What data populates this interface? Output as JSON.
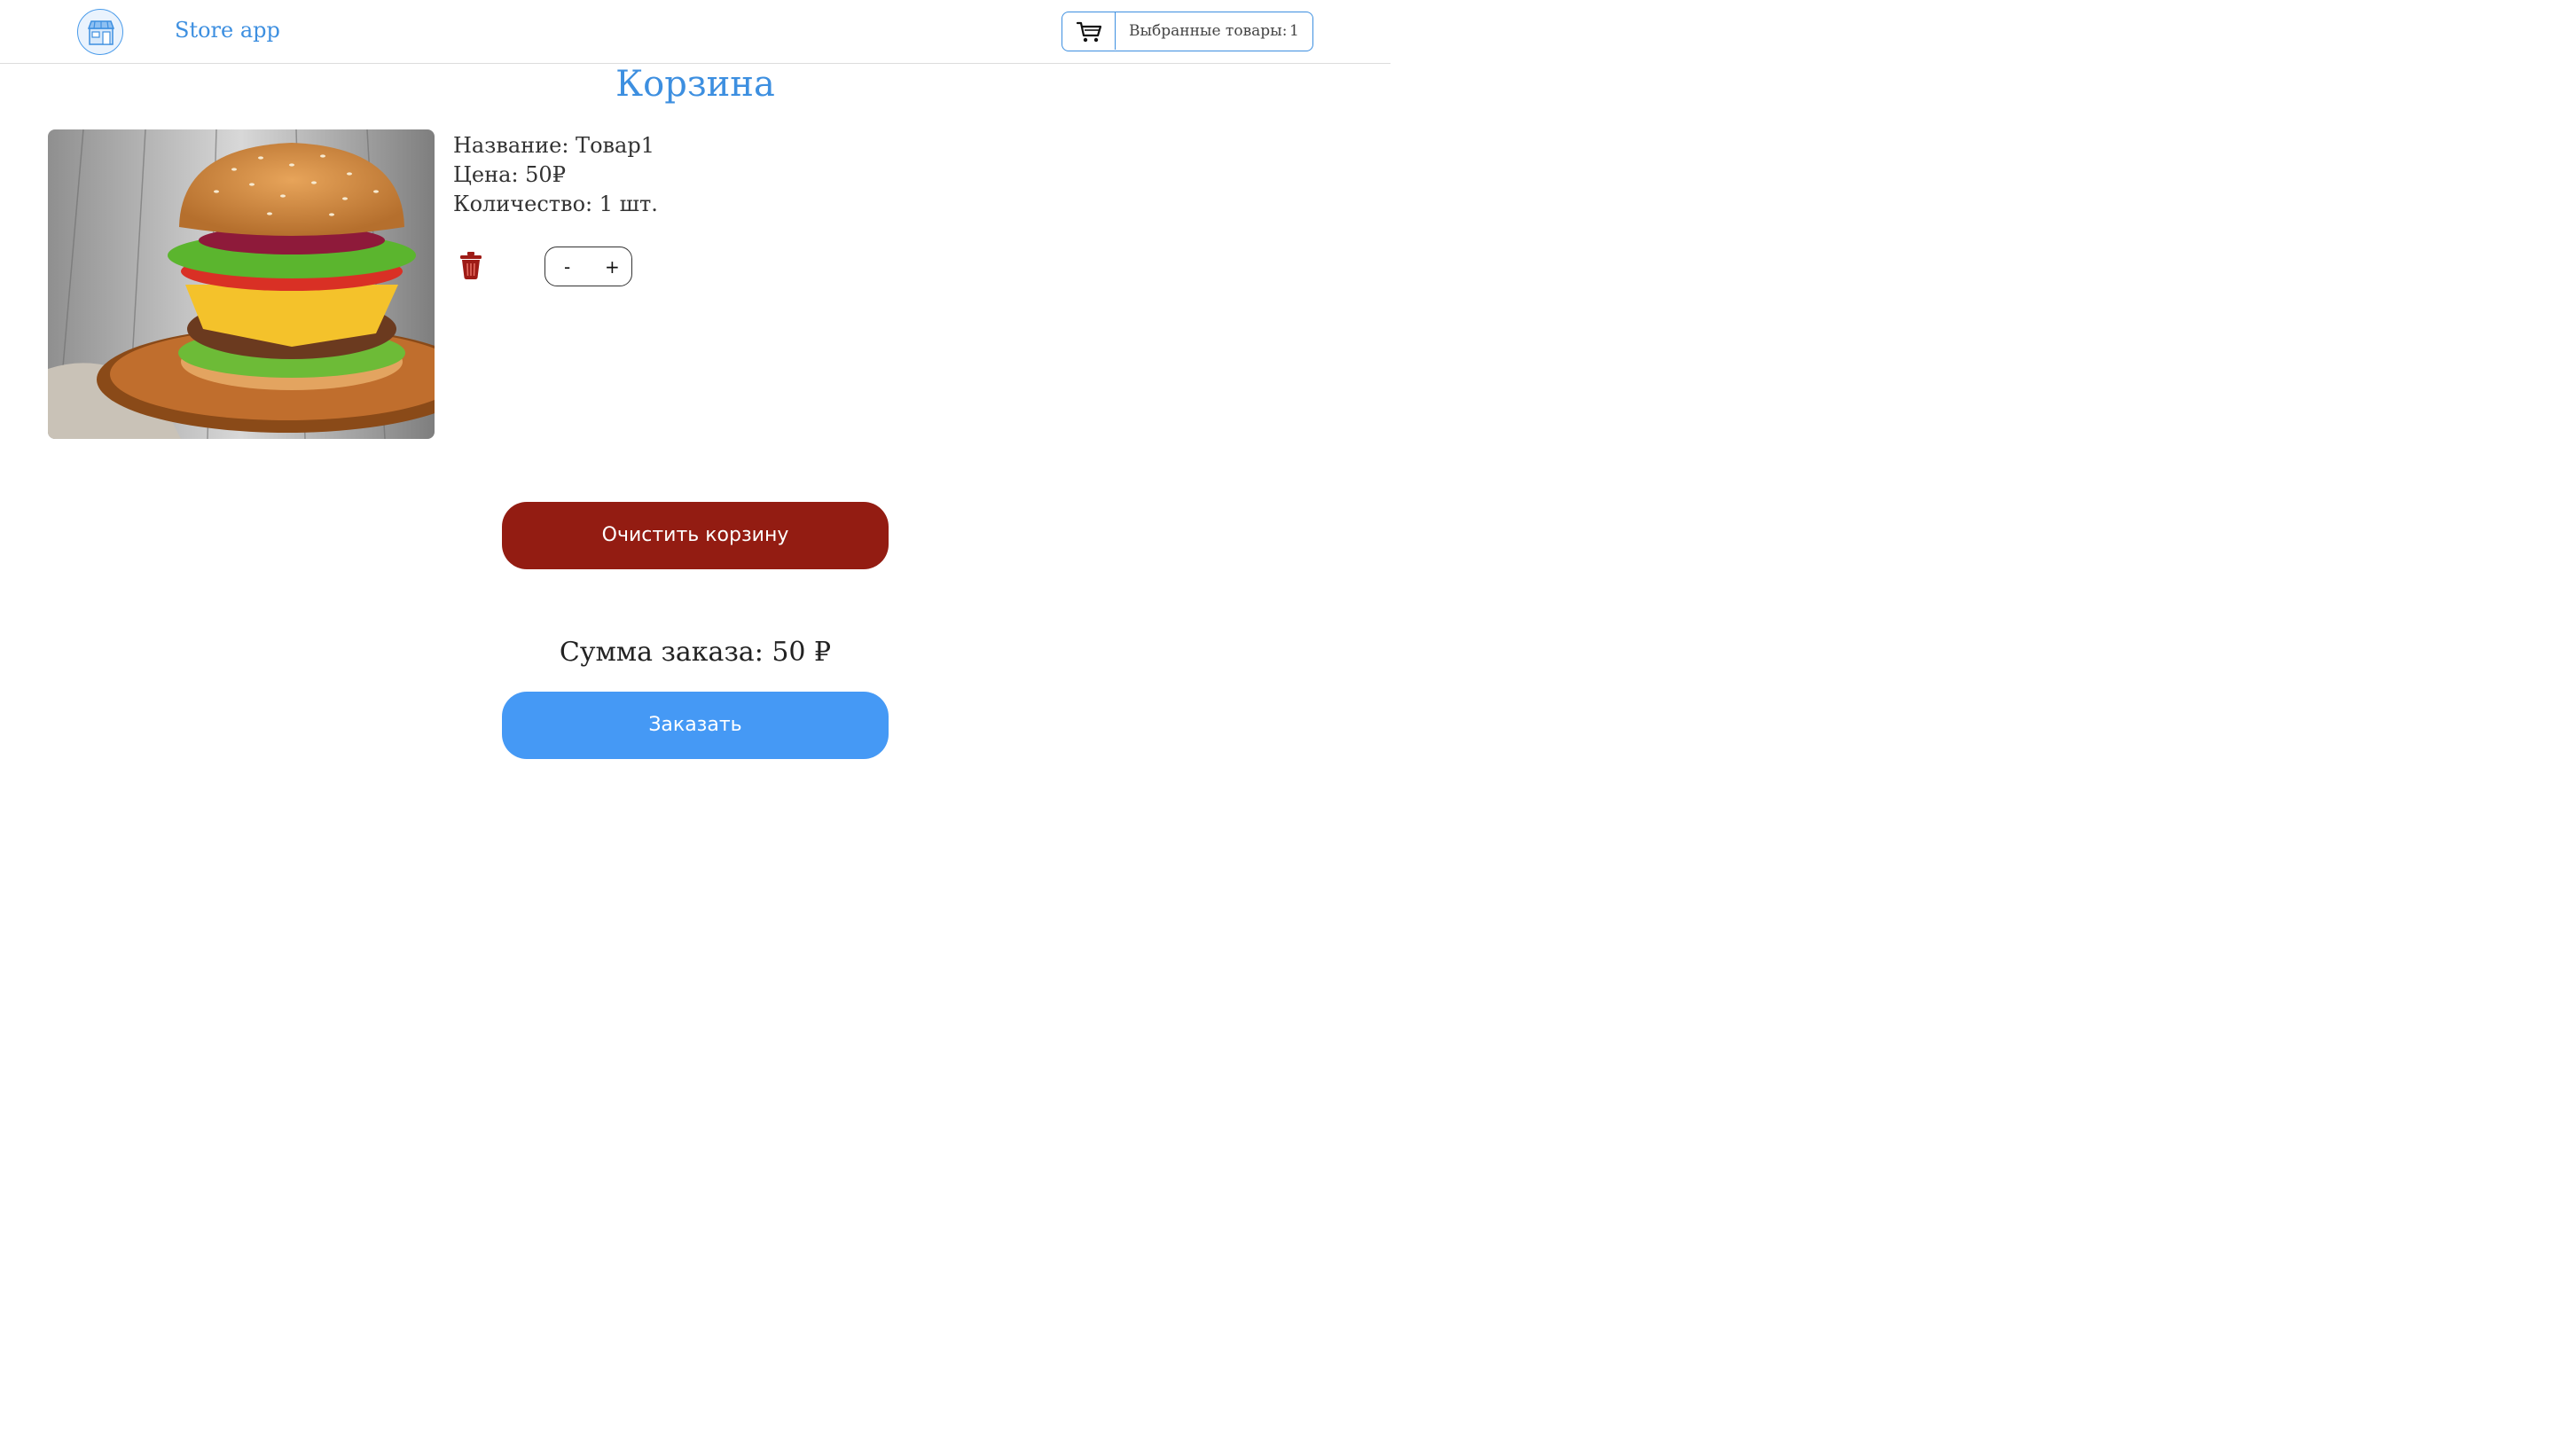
{
  "header": {
    "brand": "Store app",
    "cart_label": "Выбранные товары:",
    "cart_count": "1"
  },
  "page": {
    "title": "Корзина"
  },
  "cart": {
    "items": [
      {
        "name_line": "Название: Товар1",
        "price_line": "Цена: 50₽",
        "qty_line": "Количество: 1 шт.",
        "minus": "-",
        "plus": "+"
      }
    ]
  },
  "actions": {
    "clear_label": "Очистить корзину",
    "total_line": "Сумма заказа: 50 ₽",
    "order_label": "Заказать"
  },
  "colors": {
    "accent": "#3d8fe0",
    "clear_button": "#931c12",
    "order_button": "#4599f5"
  },
  "icons": {
    "logo": "store-icon",
    "cart": "shopping-cart-icon",
    "delete": "trash-icon"
  }
}
